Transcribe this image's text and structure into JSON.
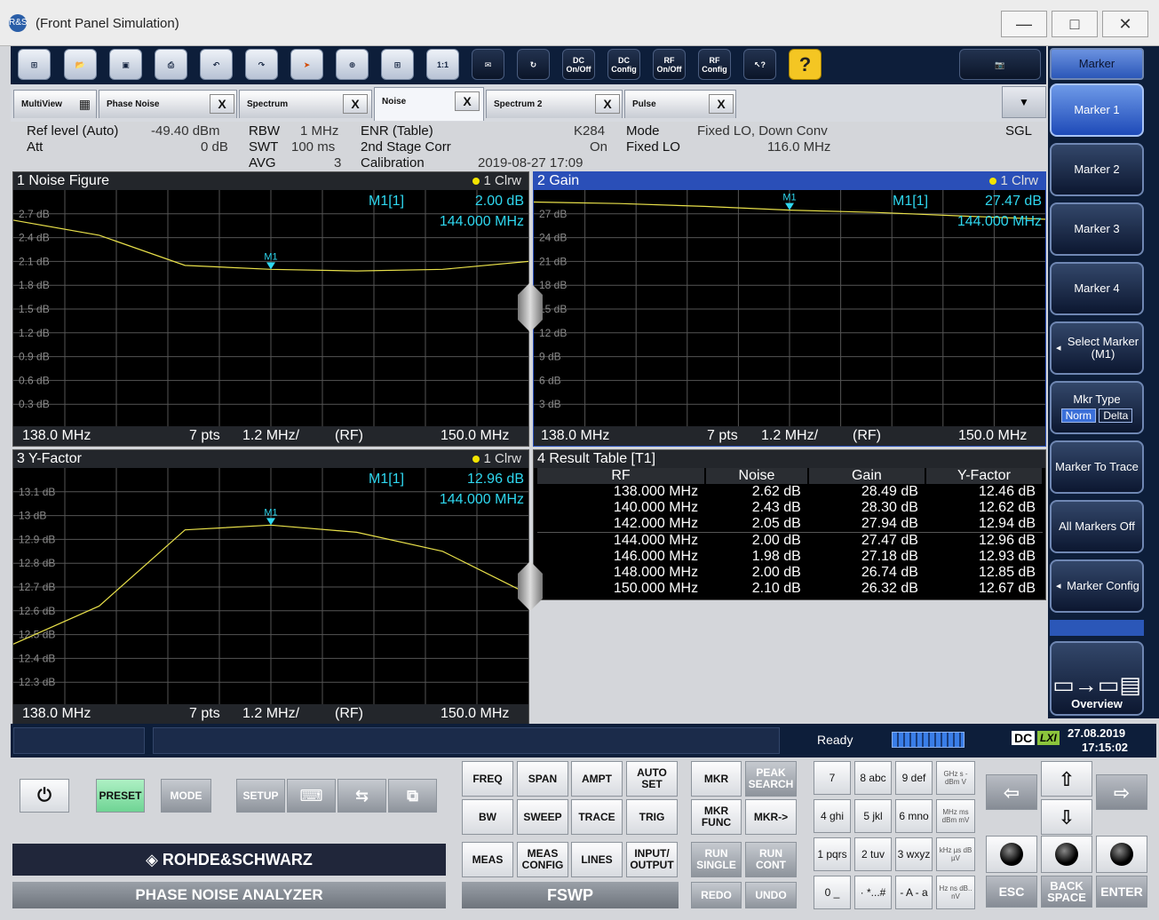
{
  "window": {
    "title": "(Front Panel Simulation)",
    "logo": "R&S",
    "min": "—",
    "max": "□",
    "close": "✕"
  },
  "toolbar": {
    "dc_onoff": "DC On/Off",
    "dc_config": "DC Config",
    "rf_onoff": "RF On/Off",
    "rf_config": "RF Config",
    "help": "?",
    "ratio": "1:1"
  },
  "tabs": [
    {
      "label": "MultiView"
    },
    {
      "label": "Phase Noise",
      "close": "X"
    },
    {
      "label": "Spectrum",
      "close": "X"
    },
    {
      "label": "Noise",
      "close": "X"
    },
    {
      "label": "Spectrum 2",
      "close": "X"
    },
    {
      "label": "Pulse",
      "close": "X"
    }
  ],
  "tab_menu": "▼",
  "settings": {
    "ref_label": "Ref level (Auto)",
    "ref_value": "-49.40 dBm",
    "att_label": "Att",
    "att_value": "0 dB",
    "rbw_label": "RBW",
    "rbw_value": "1 MHz",
    "swt_label": "SWT",
    "swt_value": "100 ms",
    "avg_label": "AVG",
    "avg_value": "3",
    "enr_label": "ENR (Table)",
    "enr_value": "K284",
    "stage_label": "2nd Stage Corr",
    "stage_value": "On",
    "cal_label": "Calibration",
    "cal_value": "2019-08-27 17:09",
    "mode_label": "Mode",
    "mode_value": "Fixed LO, Down Conv",
    "lo_label": "Fixed LO",
    "lo_value": "116.0 MHz",
    "sgl": "SGL"
  },
  "windows": {
    "nf": {
      "title": "1 Noise Figure",
      "trace": "1 Clrw",
      "marker_label": "M1[1]",
      "marker_value": "2.00 dB",
      "marker_freq": "144.000 MHz",
      "marker_tag": "M1",
      "start": "138.0 MHz",
      "pts": "7 pts",
      "div": "1.2 MHz/",
      "rf": "(RF)",
      "stop": "150.0 MHz"
    },
    "gain": {
      "title": "2 Gain",
      "trace": "1 Clrw",
      "marker_label": "M1[1]",
      "marker_value": "27.47 dB",
      "marker_freq": "144.000 MHz",
      "marker_tag": "M1",
      "start": "138.0 MHz",
      "pts": "7 pts",
      "div": "1.2 MHz/",
      "rf": "(RF)",
      "stop": "150.0 MHz"
    },
    "yf": {
      "title": "3 Y-Factor",
      "trace": "1 Clrw",
      "marker_label": "M1[1]",
      "marker_value": "12.96 dB",
      "marker_freq": "144.000 MHz",
      "marker_tag": "M1",
      "start": "138.0 MHz",
      "pts": "7 pts",
      "div": "1.2 MHz/",
      "rf": "(RF)",
      "stop": "150.0 MHz"
    },
    "rt": {
      "title": "4 Result Table [T1]"
    }
  },
  "chart_data": [
    {
      "type": "line",
      "title": "1 Noise Figure",
      "x": [
        138,
        140,
        142,
        144,
        146,
        148,
        150
      ],
      "y": [
        2.62,
        2.43,
        2.05,
        2.0,
        1.98,
        2.0,
        2.1
      ],
      "ylim": [
        0.0,
        3.0
      ],
      "ytick_labels": [
        "2.7 dB",
        "2.4 dB",
        "2.1 dB",
        "1.8 dB",
        "1.5 dB",
        "1.2 dB",
        "0.9 dB",
        "0.6 dB",
        "0.3 dB"
      ],
      "ytick_values": [
        2.7,
        2.4,
        2.1,
        1.8,
        1.5,
        1.2,
        0.9,
        0.6,
        0.3
      ],
      "xlim": [
        138,
        150
      ],
      "grid": true
    },
    {
      "type": "line",
      "title": "2 Gain",
      "x": [
        138,
        140,
        142,
        144,
        146,
        148,
        150
      ],
      "y": [
        28.49,
        28.3,
        27.94,
        27.47,
        27.18,
        26.74,
        26.32
      ],
      "ylim": [
        0,
        30
      ],
      "ytick_labels": [
        "27 dB",
        "24 dB",
        "21 dB",
        "18 dB",
        "15 dB",
        "12 dB",
        "9 dB",
        "6 dB",
        "3 dB"
      ],
      "ytick_values": [
        27,
        24,
        21,
        18,
        15,
        12,
        9,
        6,
        3
      ],
      "xlim": [
        138,
        150
      ],
      "grid": true
    },
    {
      "type": "line",
      "title": "3 Y-Factor",
      "x": [
        138,
        140,
        142,
        144,
        146,
        148,
        150
      ],
      "y": [
        12.46,
        12.62,
        12.94,
        12.96,
        12.93,
        12.85,
        12.67
      ],
      "ylim": [
        12.2,
        13.2
      ],
      "ytick_labels": [
        "13.1 dB",
        "13 dB",
        "12.9 dB",
        "12.8 dB",
        "12.7 dB",
        "12.6 dB",
        "12.5 dB",
        "12.4 dB",
        "12.3 dB"
      ],
      "ytick_values": [
        13.1,
        13.0,
        12.9,
        12.8,
        12.7,
        12.6,
        12.5,
        12.4,
        12.3
      ],
      "xlim": [
        138,
        150
      ],
      "grid": true
    },
    {
      "type": "table",
      "title": "4 Result Table [T1]",
      "columns": [
        "RF",
        "Noise",
        "Gain",
        "Y-Factor"
      ],
      "rows": [
        [
          "138.000 MHz",
          "2.62 dB",
          "28.49 dB",
          "12.46 dB"
        ],
        [
          "140.000 MHz",
          "2.43 dB",
          "28.30 dB",
          "12.62 dB"
        ],
        [
          "142.000 MHz",
          "2.05 dB",
          "27.94 dB",
          "12.94 dB"
        ],
        [
          "144.000 MHz",
          "2.00 dB",
          "27.47 dB",
          "12.96 dB"
        ],
        [
          "146.000 MHz",
          "1.98 dB",
          "27.18 dB",
          "12.93 dB"
        ],
        [
          "148.000 MHz",
          "2.00 dB",
          "26.74 dB",
          "12.85 dB"
        ],
        [
          "150.000 MHz",
          "2.10 dB",
          "26.32 dB",
          "12.67 dB"
        ]
      ]
    }
  ],
  "softkeys": {
    "header": "Marker",
    "m1": "Marker 1",
    "m2": "Marker 2",
    "m3": "Marker 3",
    "m4": "Marker 4",
    "select_marker": "Select Marker (M1)",
    "mkr_type": "Mkr Type",
    "norm": "Norm",
    "delta": "Delta",
    "to_trace": "Marker To Trace",
    "all_off": "All Markers Off",
    "config": "Marker Config",
    "overview": "Overview"
  },
  "status": {
    "ready": "Ready",
    "dc": "DC",
    "lxi": "LXI",
    "date": "27.08.2019",
    "time": "17:15:02"
  },
  "front_panel": {
    "preset": "PRESET",
    "mode": "MODE",
    "setup": "SETUP",
    "brand": "ROHDE&SCHWARZ",
    "product": "PHASE NOISE ANALYZER",
    "model": "FSWP",
    "keys": [
      "FREQ",
      "SPAN",
      "AMPT",
      "AUTO SET",
      "BW",
      "SWEEP",
      "TRACE",
      "TRIG",
      "MEAS",
      "MEAS CONFIG",
      "LINES",
      "INPUT/ OUTPUT"
    ],
    "mkr": "MKR",
    "peak": "PEAK SEARCH",
    "mkr_func": "MKR FUNC",
    "mkr_to": "MKR->",
    "run_single": "RUN SINGLE",
    "run_cont": "RUN CONT",
    "redo": "REDO",
    "undo": "UNDO",
    "num": [
      "7",
      "8 abc",
      "9 def",
      "4 ghi",
      "5 jkl",
      "6 mno",
      "1 pqrs",
      "2 tuv",
      "3 wxyz",
      "0 _",
      "· *...#",
      "- A - a"
    ],
    "units": [
      "GHz s -dBm V",
      "MHz ms dBm mV",
      "kHz µs dB µV",
      "Hz ns dB.. nV"
    ],
    "esc": "ESC",
    "backspace": "BACK SPACE",
    "enter": "ENTER"
  }
}
